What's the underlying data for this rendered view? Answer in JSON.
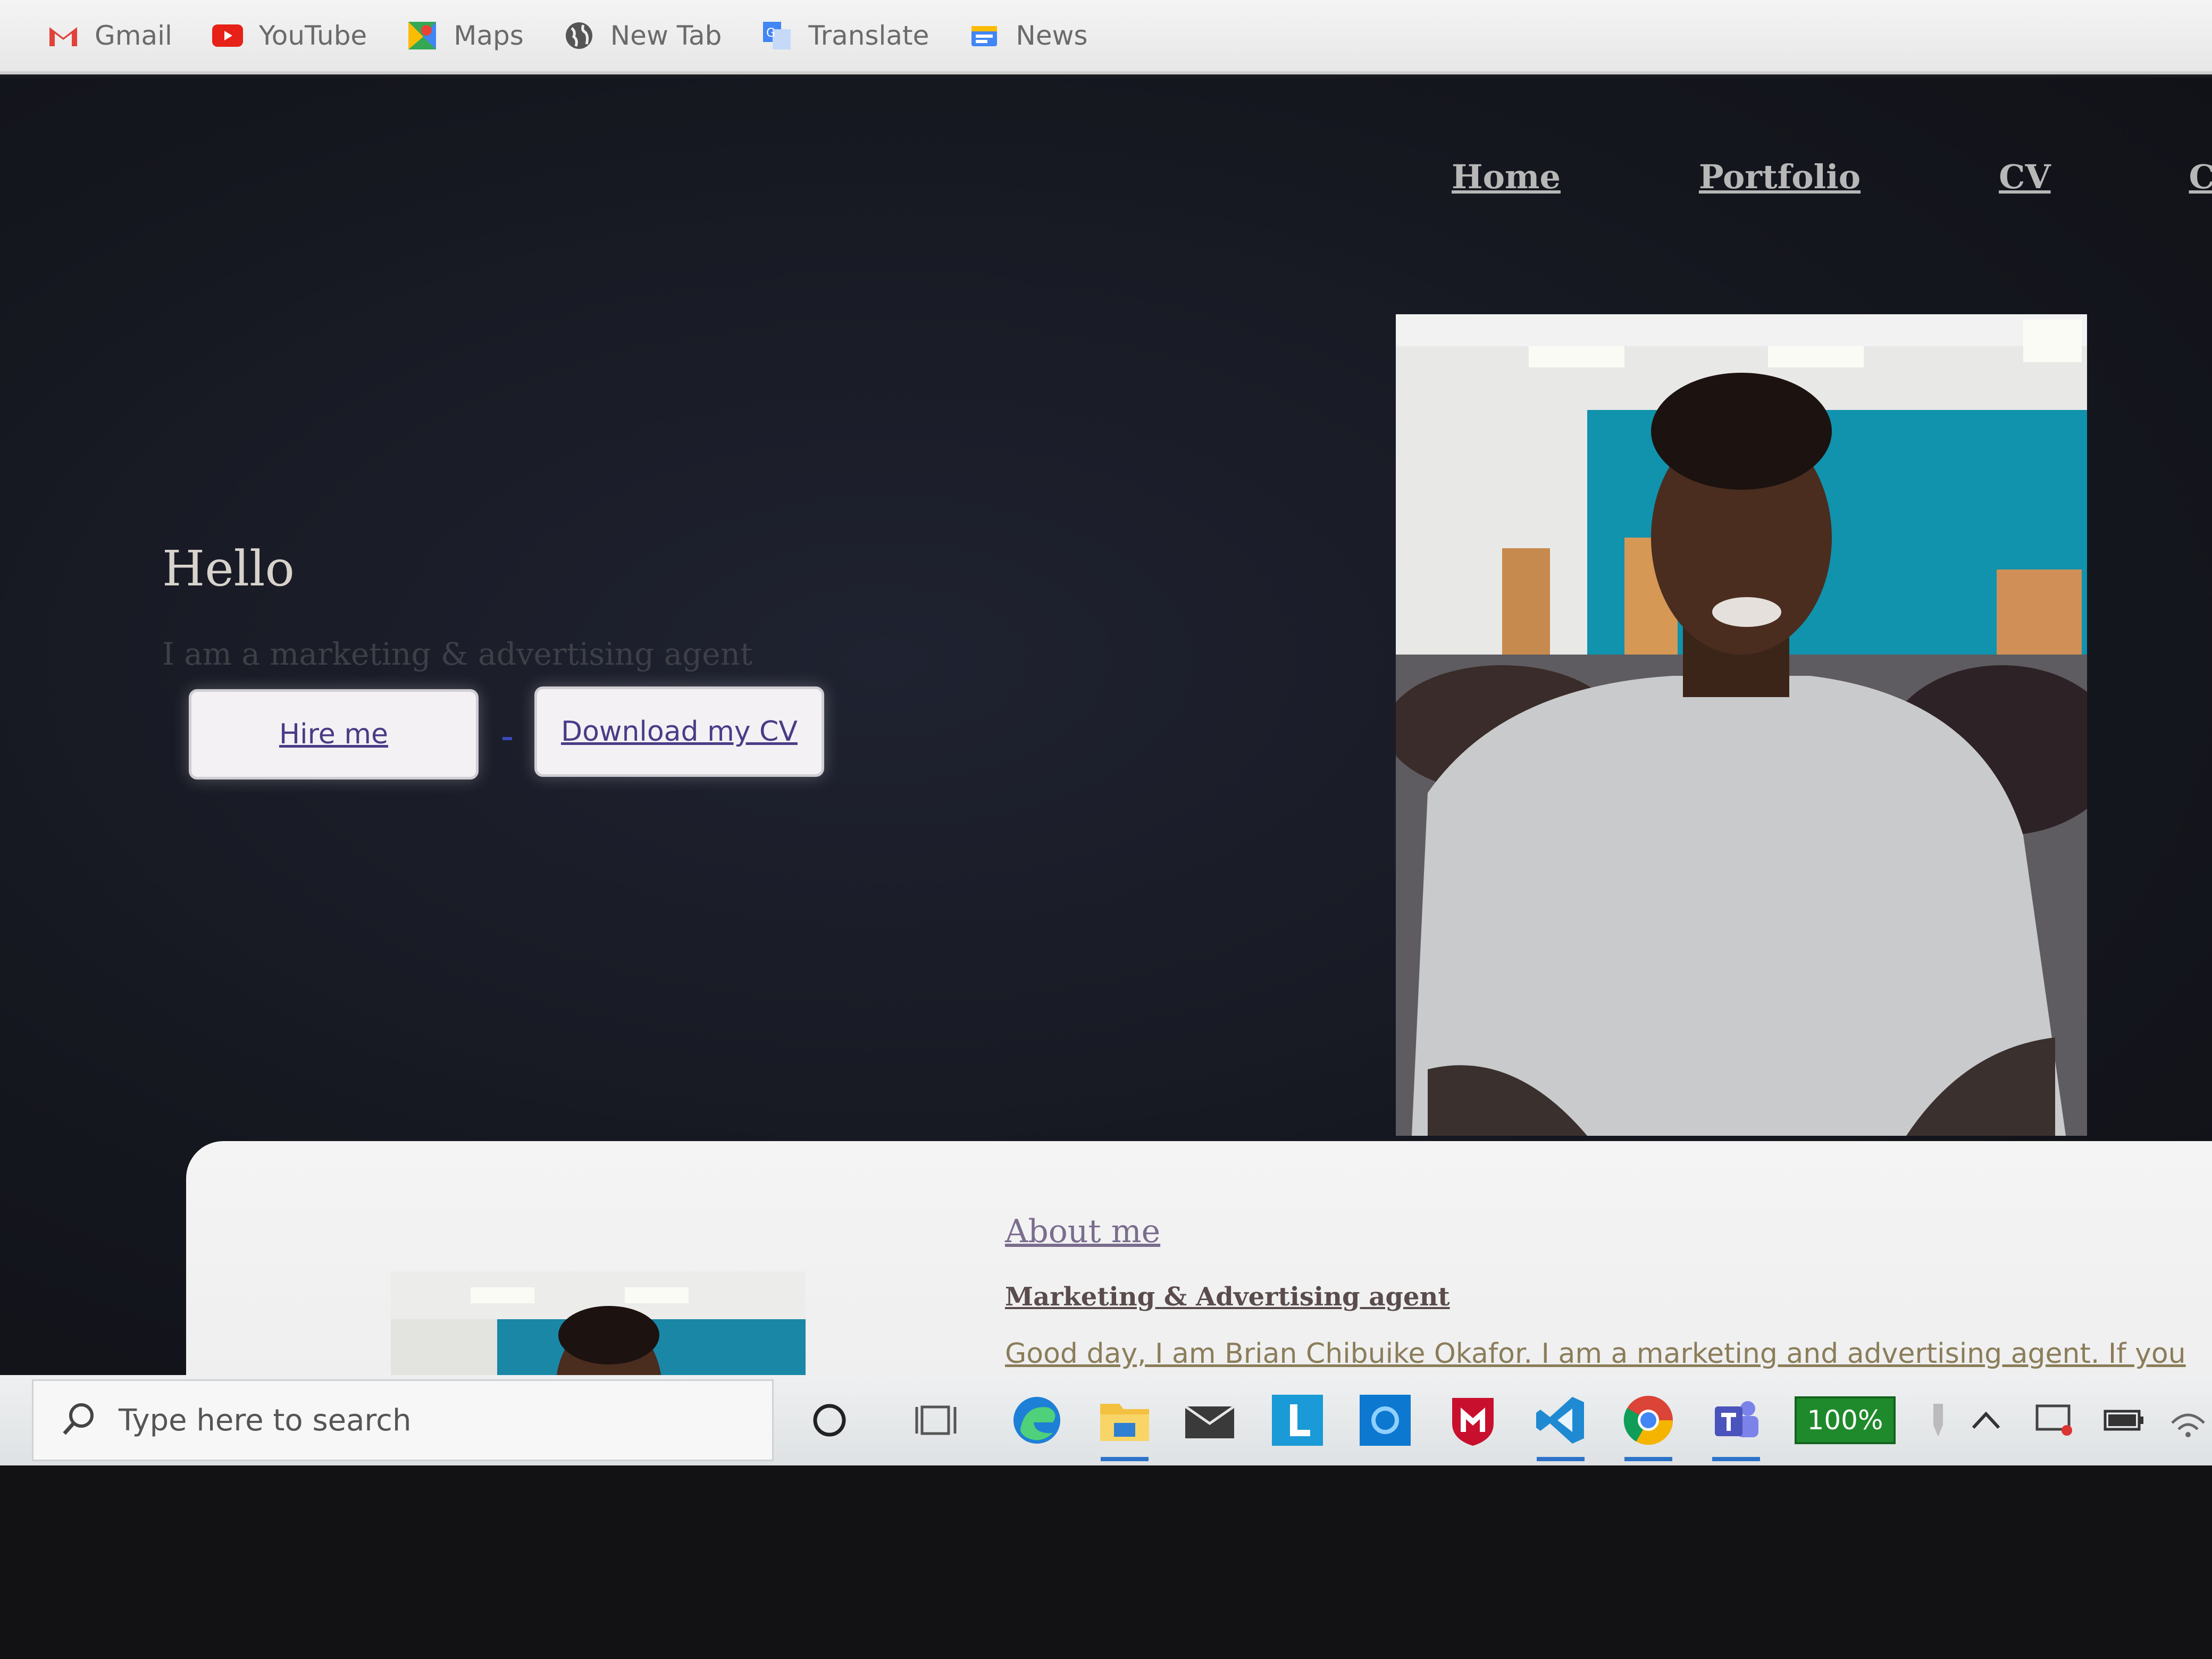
{
  "bookmarks": [
    {
      "label": "Gmail",
      "icon": "gmail-icon"
    },
    {
      "label": "YouTube",
      "icon": "youtube-icon"
    },
    {
      "label": "Maps",
      "icon": "maps-icon"
    },
    {
      "label": "New Tab",
      "icon": "globe-icon"
    },
    {
      "label": "Translate",
      "icon": "translate-icon"
    },
    {
      "label": "News",
      "icon": "news-icon"
    }
  ],
  "nav": {
    "home": "Home",
    "portfolio": "Portfolio",
    "cv": "CV",
    "contact": "Conta"
  },
  "hero": {
    "greeting": "Hello",
    "tagline": "I am a marketing & advertising agent",
    "hire_button": "Hire me",
    "cv_button": "Download my CV"
  },
  "about": {
    "title": "About me",
    "subtitle": "Marketing & Advertising agent",
    "text": "Good day, I am Brian Chibuike Okafor. I am a marketing and advertising agent. If you"
  },
  "taskbar": {
    "search_placeholder": "Type here to search",
    "battery": "100%",
    "apps": [
      "cortana-icon",
      "task-view-icon",
      "edge-icon",
      "file-explorer-icon",
      "mail-icon",
      "l-app-icon",
      "store-app-icon",
      "mcafee-icon",
      "vscode-icon",
      "chrome-icon",
      "teams-icon"
    ]
  },
  "colors": {
    "page_bg": "#15171f",
    "button_text": "#4b3a87",
    "battery_green": "#1f8a2b"
  }
}
